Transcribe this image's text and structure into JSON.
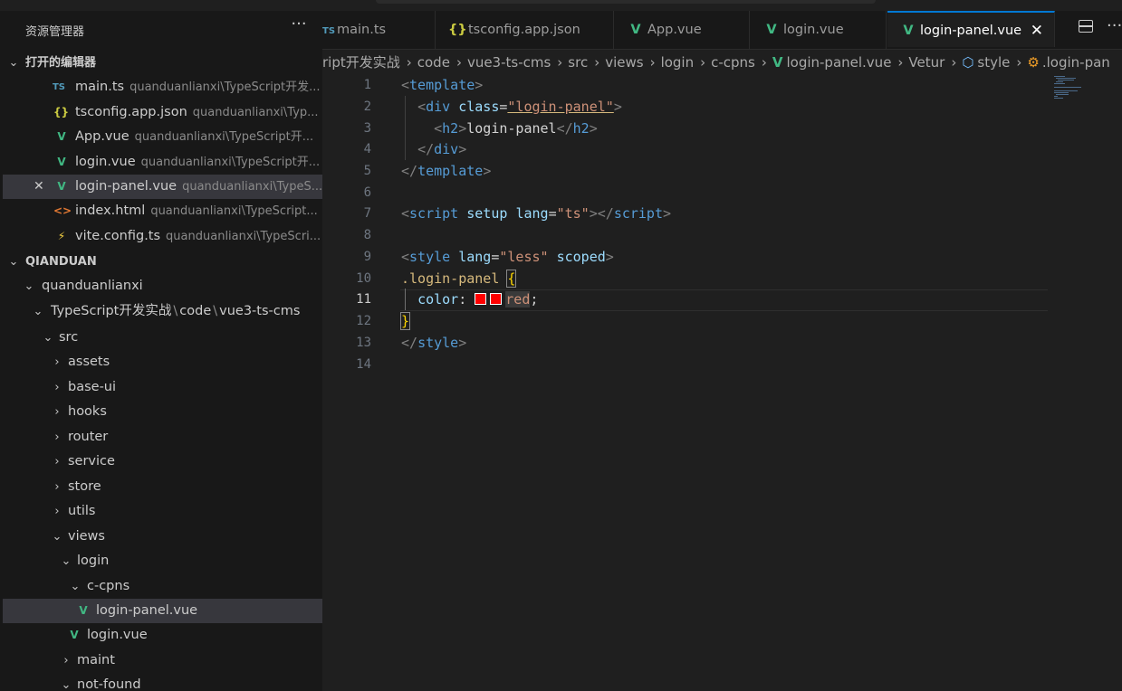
{
  "explorer": {
    "title": "资源管理器",
    "more": "···",
    "open_editors_title": "打开的编辑器",
    "open_editors": [
      {
        "name": "main.ts",
        "path": "quanduanlianxi\\TypeScript开发...",
        "icon": "ts-icon",
        "glyph": "TS"
      },
      {
        "name": "tsconfig.app.json",
        "path": "quanduanlianxi\\Typ...",
        "icon": "json-icon",
        "glyph": "{}"
      },
      {
        "name": "App.vue",
        "path": "quanduanlianxi\\TypeScript开...",
        "icon": "vue-icon",
        "glyph": "V"
      },
      {
        "name": "login.vue",
        "path": "quanduanlianxi\\TypeScript开...",
        "icon": "vue-icon",
        "glyph": "V"
      },
      {
        "name": "login-panel.vue",
        "path": "quanduanlianxi\\TypeS...",
        "icon": "vue-icon",
        "glyph": "V"
      },
      {
        "name": "index.html",
        "path": "quanduanlianxi\\TypeScript...",
        "icon": "html-icon",
        "glyph": "<>"
      },
      {
        "name": "vite.config.ts",
        "path": "quanduanlianxi\\TypeScri...",
        "icon": "vite-icon",
        "glyph": "⚡"
      }
    ],
    "workspace_title": "QIANDUAN",
    "tree": {
      "root": "quanduanlianxi",
      "compact_folder": [
        "TypeScript开发实战",
        "code",
        "vue3-ts-cms"
      ],
      "compact_sep": "\\",
      "src": "src",
      "assets": "assets",
      "base_ui": "base-ui",
      "hooks": "hooks",
      "router": "router",
      "service": "service",
      "store": "store",
      "utils": "utils",
      "views": "views",
      "login": "login",
      "c_cpns": "c-cpns",
      "login_panel_file": "login-panel.vue",
      "login_file": "login.vue",
      "maint": "maint",
      "not_found": "not-found"
    }
  },
  "tabs": [
    {
      "label": "main.ts",
      "icon": "ts-icon",
      "glyph": "TS"
    },
    {
      "label": "tsconfig.app.json",
      "icon": "json-icon",
      "glyph": "{}"
    },
    {
      "label": "App.vue",
      "icon": "vue-icon",
      "glyph": "V"
    },
    {
      "label": "login.vue",
      "icon": "vue-icon",
      "glyph": "V"
    },
    {
      "label": "login-panel.vue",
      "icon": "vue-icon",
      "glyph": "V",
      "active": true
    }
  ],
  "tab_close": "✕",
  "breadcrumb": [
    "ript开发实战",
    "code",
    "vue3-ts-cms",
    "src",
    "views",
    "login",
    "c-cpns",
    "login-panel.vue",
    "Vetur",
    "style",
    ".login-pan"
  ],
  "editor": {
    "current_line": 11,
    "lines": [
      "1",
      "2",
      "3",
      "4",
      "5",
      "6",
      "7",
      "8",
      "9",
      "10",
      "11",
      "12",
      "13",
      "14"
    ],
    "code": {
      "l1_tag": "template",
      "l2_tag": "div",
      "l2_attr": "class",
      "l2_val": "\"login-panel\"",
      "l3_tag": "h2",
      "l3_text": "login-panel",
      "l4_tag": "div",
      "l5_tag": "template",
      "l7_tag": "script",
      "l7_a1": "setup",
      "l7_a2": "lang",
      "l7_v2": "\"ts\"",
      "l9_tag": "style",
      "l9_a1": "lang",
      "l9_v1": "\"less\"",
      "l9_a2": "scoped",
      "l10_sel": ".login-panel",
      "l10_brace": "{",
      "l11_prop": "color",
      "l11_val": "red",
      "l12_brace": "}",
      "l13_tag": "style"
    }
  },
  "colors": {
    "accent": "#0078d4",
    "vue": "#41b883",
    "swatch": "#ff0000"
  }
}
